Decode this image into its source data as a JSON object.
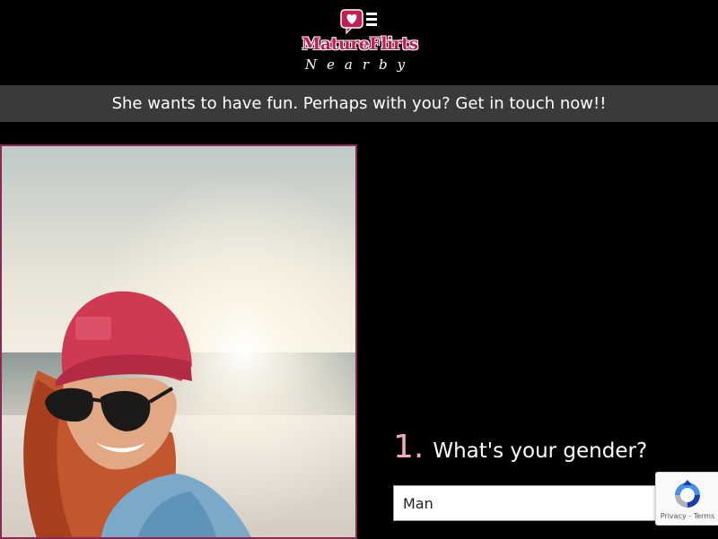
{
  "header": {
    "logo_main": "MatureFlirts",
    "logo_sub": "Nearby",
    "brand_color": "#c41e58"
  },
  "banner": {
    "text": "She wants to have fun. Perhaps with you? Get in touch now!!"
  },
  "question": {
    "number": "1.",
    "text": "What's your gender?",
    "number_color": "#f2a9c8"
  },
  "gender_select": {
    "value": "Man"
  },
  "recaptcha": {
    "privacy": "Privacy",
    "separator": " - ",
    "terms": "Terms"
  }
}
